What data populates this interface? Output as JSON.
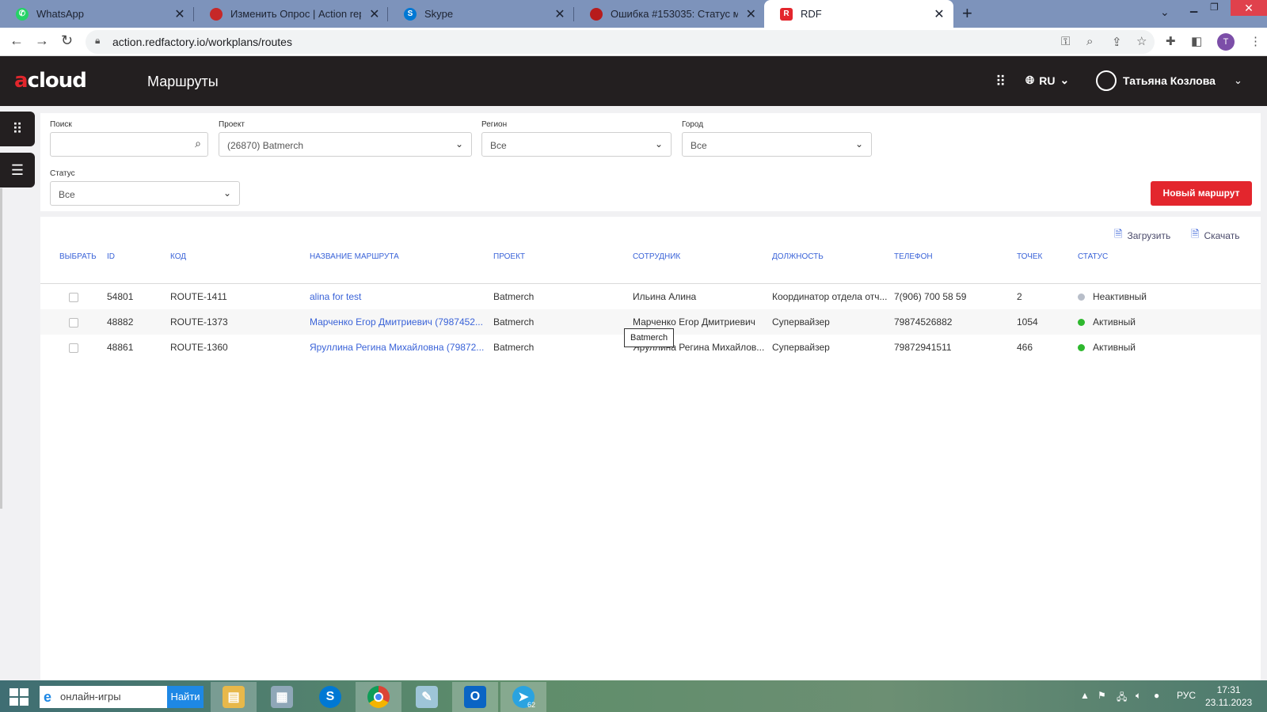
{
  "browser": {
    "tabs": [
      {
        "title": "WhatsApp",
        "icon": "whatsapp-icon",
        "color": "#25d366"
      },
      {
        "title": "Изменить Опрос | Action report",
        "icon": "action-report-icon",
        "color": "#c62828"
      },
      {
        "title": "Skype",
        "icon": "skype-icon",
        "color": "#0078d4"
      },
      {
        "title": "Ошибка #153035: Статус маршру",
        "icon": "redmine-icon",
        "color": "#b71c1c"
      },
      {
        "title": "RDF",
        "icon": "rdf-icon",
        "color": "#e3262d"
      }
    ],
    "url": "action.redfactory.io/workplans/routes",
    "profile_letter": "T"
  },
  "app": {
    "logo_a": "a",
    "logo_rest": "cloud",
    "page_title": "Маршруты",
    "language": "RU",
    "user_name": "Татьяна Козлова"
  },
  "filters": {
    "search": {
      "label": "Поиск",
      "value": ""
    },
    "project": {
      "label": "Проект",
      "value": "(26870) Batmerch"
    },
    "region": {
      "label": "Регион",
      "value": "Все"
    },
    "city": {
      "label": "Город",
      "value": "Все"
    },
    "status": {
      "label": "Статус",
      "value": "Все"
    },
    "new_route_label": "Новый маршрут"
  },
  "table": {
    "upload_label": "Загрузить",
    "download_label": "Скачать",
    "columns": [
      "Выбрать",
      "ID",
      "Код",
      "Название маршрута",
      "Проект",
      "Сотрудник",
      "Должность",
      "Телефон",
      "Точек",
      "Статус"
    ],
    "rows": [
      {
        "id": "54801",
        "code": "ROUTE-1411",
        "name": "alina for test",
        "project": "Batmerch",
        "employee": "Ильина Алина",
        "position": "Координатор отдела отч...",
        "phone": "7(906) 700 58 59",
        "points": "2",
        "status": "Неактивный",
        "status_color": "#b8bec9"
      },
      {
        "id": "48882",
        "code": "ROUTE-1373",
        "name": "Марченко Егор Дмитриевич (7987452...",
        "project": "Batmerch",
        "employee": "Марченко Егор Дмитриевич",
        "position": "Супервайзер",
        "phone": "79874526882",
        "points": "1054",
        "status": "Активный",
        "status_color": "#2eb82e"
      },
      {
        "id": "48861",
        "code": "ROUTE-1360",
        "name": "Яруллина Регина Михайловна (79872...",
        "project": "Batmerch",
        "employee": "Яруллина Регина Михайлов...",
        "position": "Супервайзер",
        "phone": "79872941511",
        "points": "466",
        "status": "Активный",
        "status_color": "#2eb82e"
      }
    ],
    "tooltip": "Batmerch"
  },
  "taskbar": {
    "search_text": "онлайн-игры",
    "search_button": "Найти",
    "telegram_badge": "62",
    "language": "РУС",
    "time": "17:31",
    "date": "23.11.2023"
  }
}
